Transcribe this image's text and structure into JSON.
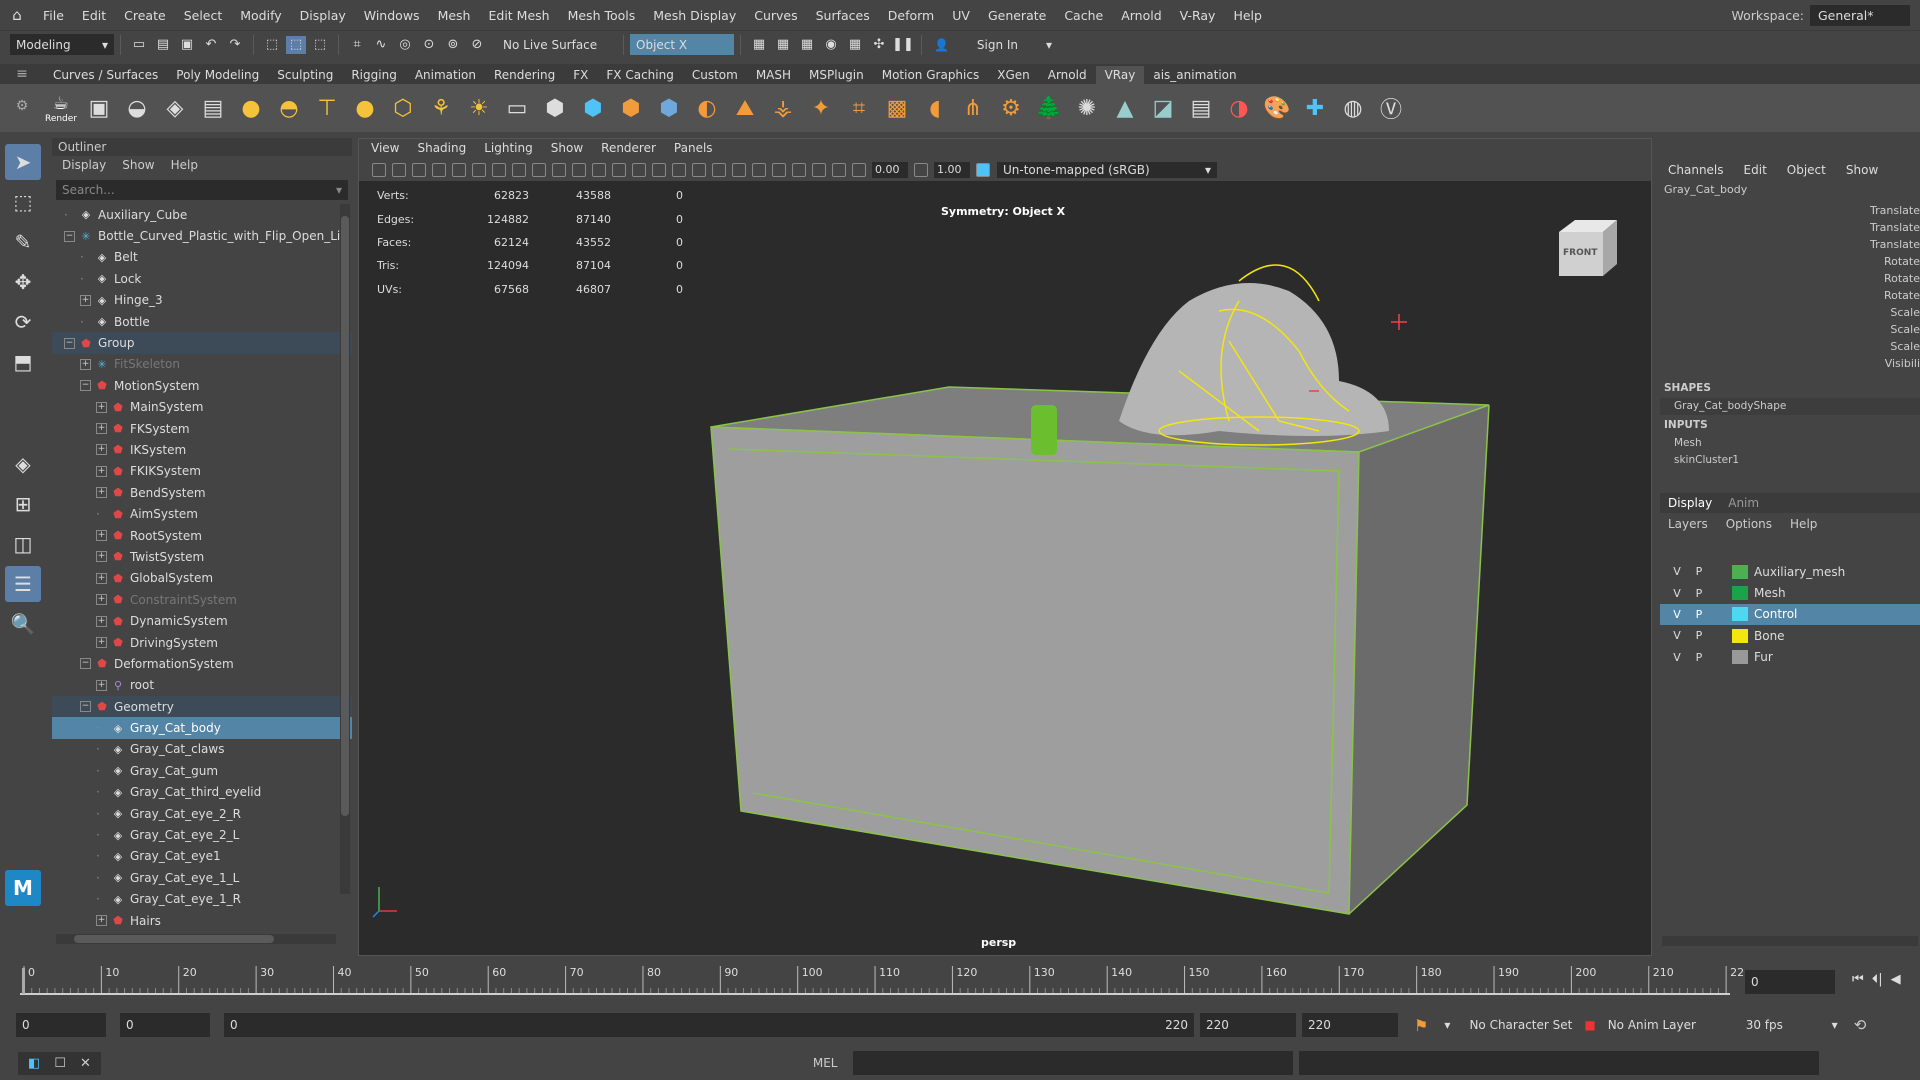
{
  "menubar": {
    "items": [
      "File",
      "Edit",
      "Create",
      "Select",
      "Modify",
      "Display",
      "Windows",
      "Mesh",
      "Edit Mesh",
      "Mesh Tools",
      "Mesh Display",
      "Curves",
      "Surfaces",
      "Deform",
      "UV",
      "Generate",
      "Cache",
      "Arnold",
      "V-Ray",
      "Help"
    ],
    "workspace_label": "Workspace:",
    "workspace_value": "General*"
  },
  "statusline": {
    "mode": "Modeling",
    "live_surface": "No Live Surface",
    "symmetry": "Object X",
    "sign_in": "Sign In"
  },
  "shelf": {
    "tabs": [
      "Curves / Surfaces",
      "Poly Modeling",
      "Sculpting",
      "Rigging",
      "Animation",
      "Rendering",
      "FX",
      "FX Caching",
      "Custom",
      "MASH",
      "MSPlugin",
      "Motion Graphics",
      "XGen",
      "Arnold",
      "VRay",
      "ais_animation"
    ],
    "active_tab": "VRay",
    "render_label": "Render"
  },
  "outliner": {
    "title": "Outliner",
    "menus": [
      "Display",
      "Show",
      "Help"
    ],
    "search_placeholder": "Search...",
    "rows": [
      {
        "label": "Auxiliary_Cube",
        "indent": 1,
        "icon": "mesh",
        "exp": ""
      },
      {
        "label": "Bottle_Curved_Plastic_with_Flip_Open_Li",
        "indent": 1,
        "icon": "cv",
        "exp": "-"
      },
      {
        "label": "Belt",
        "indent": 2,
        "icon": "mesh",
        "exp": ""
      },
      {
        "label": "Lock",
        "indent": 2,
        "icon": "mesh",
        "exp": ""
      },
      {
        "label": "Hinge_3",
        "indent": 2,
        "icon": "mesh",
        "exp": "+"
      },
      {
        "label": "Bottle",
        "indent": 2,
        "icon": "mesh",
        "exp": ""
      },
      {
        "label": "Group",
        "indent": 1,
        "icon": "grp",
        "exp": "-",
        "state": "grp"
      },
      {
        "label": "FitSkeleton",
        "indent": 2,
        "icon": "cv",
        "exp": "+",
        "state": "dim"
      },
      {
        "label": "MotionSystem",
        "indent": 2,
        "icon": "grp",
        "exp": "-"
      },
      {
        "label": "MainSystem",
        "indent": 3,
        "icon": "grp",
        "exp": "+"
      },
      {
        "label": "FKSystem",
        "indent": 3,
        "icon": "grp",
        "exp": "+"
      },
      {
        "label": "IKSystem",
        "indent": 3,
        "icon": "grp",
        "exp": "+"
      },
      {
        "label": "FKIKSystem",
        "indent": 3,
        "icon": "grp",
        "exp": "+"
      },
      {
        "label": "BendSystem",
        "indent": 3,
        "icon": "grp",
        "exp": "+"
      },
      {
        "label": "AimSystem",
        "indent": 3,
        "icon": "grp",
        "exp": ""
      },
      {
        "label": "RootSystem",
        "indent": 3,
        "icon": "grp",
        "exp": "+"
      },
      {
        "label": "TwistSystem",
        "indent": 3,
        "icon": "grp",
        "exp": "+"
      },
      {
        "label": "GlobalSystem",
        "indent": 3,
        "icon": "grp",
        "exp": "+"
      },
      {
        "label": "ConstraintSystem",
        "indent": 3,
        "icon": "grp",
        "exp": "+",
        "state": "dim"
      },
      {
        "label": "DynamicSystem",
        "indent": 3,
        "icon": "grp",
        "exp": "+"
      },
      {
        "label": "DrivingSystem",
        "indent": 3,
        "icon": "grp",
        "exp": "+"
      },
      {
        "label": "DeformationSystem",
        "indent": 2,
        "icon": "grp",
        "exp": "-"
      },
      {
        "label": "root",
        "indent": 3,
        "icon": "jnt",
        "exp": "+"
      },
      {
        "label": "Geometry",
        "indent": 2,
        "icon": "grp",
        "exp": "-",
        "state": "grp"
      },
      {
        "label": "Gray_Cat_body",
        "indent": 3,
        "icon": "mesh",
        "exp": "",
        "state": "sel"
      },
      {
        "label": "Gray_Cat_claws",
        "indent": 3,
        "icon": "mesh",
        "exp": ""
      },
      {
        "label": "Gray_Cat_gum",
        "indent": 3,
        "icon": "mesh",
        "exp": ""
      },
      {
        "label": "Gray_Cat_third_eyelid",
        "indent": 3,
        "icon": "mesh",
        "exp": ""
      },
      {
        "label": "Gray_Cat_eye_2_R",
        "indent": 3,
        "icon": "mesh",
        "exp": ""
      },
      {
        "label": "Gray_Cat_eye_2_L",
        "indent": 3,
        "icon": "mesh",
        "exp": ""
      },
      {
        "label": "Gray_Cat_eye1",
        "indent": 3,
        "icon": "mesh",
        "exp": ""
      },
      {
        "label": "Gray_Cat_eye_1_L",
        "indent": 3,
        "icon": "mesh",
        "exp": ""
      },
      {
        "label": "Gray_Cat_eye_1_R",
        "indent": 3,
        "icon": "mesh",
        "exp": ""
      },
      {
        "label": "Hairs",
        "indent": 3,
        "icon": "grp",
        "exp": "+"
      }
    ]
  },
  "viewport": {
    "menus": [
      "View",
      "Shading",
      "Lighting",
      "Show",
      "Renderer",
      "Panels"
    ],
    "exposure": "0.00",
    "gamma": "1.00",
    "color_space": "Un-tone-mapped (sRGB)",
    "hud": [
      [
        "Verts:",
        "62823",
        "43588",
        "0"
      ],
      [
        "Edges:",
        "124882",
        "87140",
        "0"
      ],
      [
        "Faces:",
        "62124",
        "43552",
        "0"
      ],
      [
        "Tris:",
        "124094",
        "87104",
        "0"
      ],
      [
        "UVs:",
        "67568",
        "46807",
        "0"
      ]
    ],
    "symmetry": "Symmetry: Object X",
    "camera": "persp",
    "viewcube": "FRONT"
  },
  "channelbox": {
    "menus": [
      "Channels",
      "Edit",
      "Object",
      "Show"
    ],
    "object": "Gray_Cat_body",
    "attrs": [
      "Translate",
      "Translate",
      "Translate",
      "Rotate",
      "Rotate",
      "Rotate",
      "Scale",
      "Scale",
      "Scale",
      "Visibili"
    ],
    "shapes_header": "SHAPES",
    "shape": "Gray_Cat_bodyShape",
    "inputs_header": "INPUTS",
    "inputs": [
      "Mesh",
      "skinCluster1"
    ]
  },
  "layers": {
    "tabs": [
      "Display",
      "Anim"
    ],
    "menus": [
      "Layers",
      "Options",
      "Help"
    ],
    "rows": [
      {
        "v": "V",
        "p": "P",
        "name": "Auxiliary_mesh",
        "color": "#4caf50"
      },
      {
        "v": "V",
        "p": "P",
        "name": "Mesh",
        "color": "#1aa34a"
      },
      {
        "v": "V",
        "p": "P",
        "name": "Control",
        "color": "#4fd6f0",
        "sel": true
      },
      {
        "v": "V",
        "p": "P",
        "name": "Bone",
        "color": "#f2e60e"
      },
      {
        "v": "V",
        "p": "P",
        "name": "Fur",
        "color": "#999999"
      }
    ]
  },
  "timeline": {
    "ticks": [
      "0",
      "10",
      "20",
      "30",
      "40",
      "50",
      "60",
      "70",
      "80",
      "90",
      "100",
      "110",
      "120",
      "130",
      "140",
      "150",
      "160",
      "170",
      "180",
      "190",
      "200",
      "210",
      "22"
    ],
    "current": "0"
  },
  "range": {
    "start": "0",
    "playback_start": "0",
    "slider_start": "0",
    "slider_end": "220",
    "end": "220",
    "anim_end": "220",
    "character_set": "No Character Set",
    "anim_layer": "No Anim Layer",
    "fps": "30 fps"
  },
  "cmdline": {
    "lang": "MEL"
  }
}
